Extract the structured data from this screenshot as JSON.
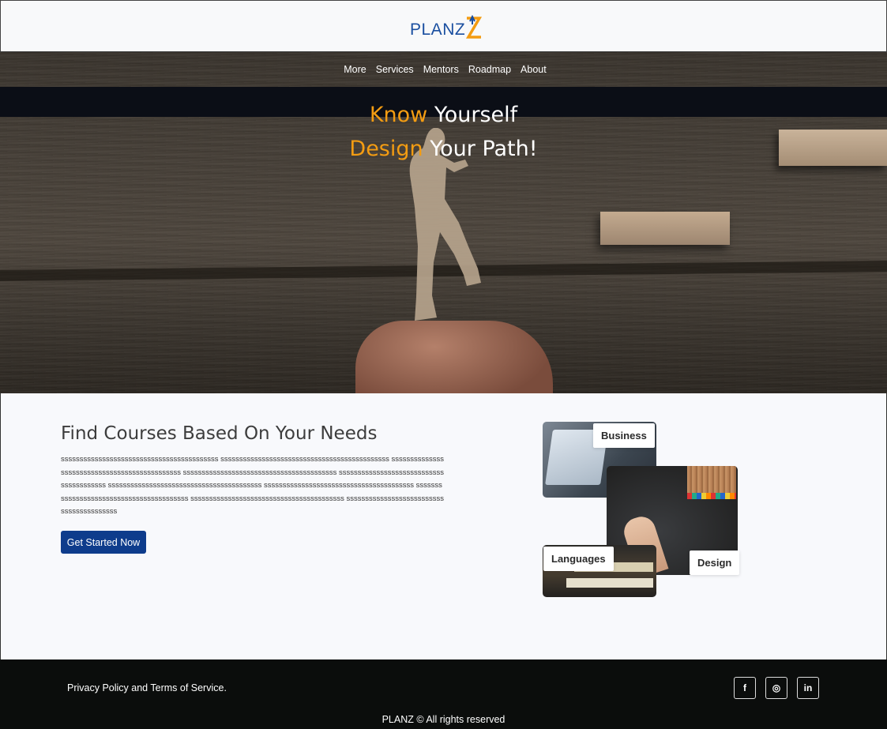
{
  "brand": {
    "name": "PLANZ",
    "primary_color": "#1a4fa0",
    "accent_color": "#f39c12"
  },
  "nav": {
    "items": [
      "More",
      "Services",
      "Mentors",
      "Roadmap",
      "About"
    ]
  },
  "hero": {
    "line1_accent": "Know",
    "line1_rest": " Yourself",
    "line2_accent": "Design",
    "line2_rest": " Your Path!"
  },
  "courses": {
    "title": "Find Courses Based On Your Needs",
    "body": "ssssssssssssssssssssssssssssssssssssssssss sssssssssssssssssssssssssssssssssssssssssssss ssssssssssssssssssssssssssssssssssssssssssssss sssssssssssssssssssssssssssssssssssssssss ssssssssssssssssssssssssssssssssssssssss sssssssssssssssssssssssssssssssssssssssss ssssssssssssssssssssssssssssssssssssssss sssssssssssssssssssssssssssssssssssssssss sssssssssssssssssssssssssssssssssssssssss sssssssssssssssssssssssssssssssssssssssss",
    "cta_label": "Get Started Now",
    "cta_color": "#0e3c8c",
    "collage_tags": {
      "business": "Business",
      "languages": "Languages",
      "design": "Design"
    }
  },
  "footer": {
    "links_text": "Privacy Policy and Terms of Service.",
    "copyright": "PLANZ © All rights reserved",
    "socials": [
      {
        "name": "facebook-icon",
        "glyph": "f"
      },
      {
        "name": "instagram-icon",
        "glyph": "◎"
      },
      {
        "name": "linkedin-icon",
        "glyph": "in"
      }
    ]
  }
}
